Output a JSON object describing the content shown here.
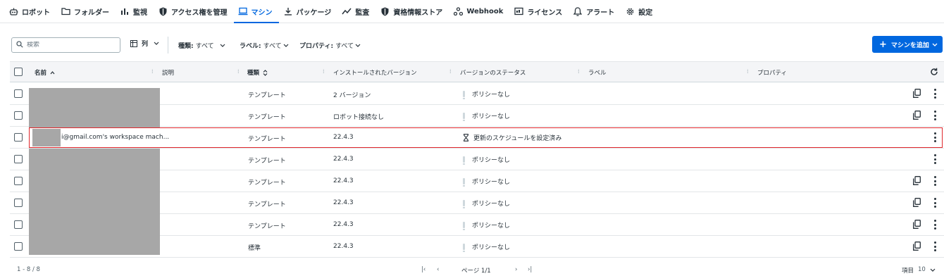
{
  "nav": {
    "items": [
      {
        "label": "ロボット",
        "icon": "robot-icon"
      },
      {
        "label": "フォルダー",
        "icon": "folder-icon"
      },
      {
        "label": "監視",
        "icon": "chart-icon"
      },
      {
        "label": "アクセス権を管理",
        "icon": "shield-icon"
      },
      {
        "label": "マシン",
        "icon": "laptop-icon",
        "active": true
      },
      {
        "label": "パッケージ",
        "icon": "download-icon"
      },
      {
        "label": "監査",
        "icon": "trend-icon"
      },
      {
        "label": "資格情報ストア",
        "icon": "shield-icon"
      },
      {
        "label": "Webhook",
        "icon": "webhook-icon"
      },
      {
        "label": "ライセンス",
        "icon": "license-icon"
      },
      {
        "label": "アラート",
        "icon": "bell-icon"
      },
      {
        "label": "設定",
        "icon": "gear-icon"
      }
    ]
  },
  "toolbar": {
    "search_placeholder": "検索",
    "columns_label": "列",
    "filters": {
      "type_label": "種類:",
      "type_value": "すべて",
      "labels_label": "ラベル:",
      "labels_value": "すべて",
      "props_label": "プロパティ:",
      "props_value": "すべて"
    },
    "add_label": "マシンを追加"
  },
  "table": {
    "headers": {
      "name": "名前",
      "description": "説明",
      "type": "種類",
      "installed_versions": "インストールされたバージョン",
      "version_status": "バージョンのステータス",
      "labels": "ラベル",
      "properties": "プロパティ"
    },
    "rows": [
      {
        "name": "",
        "type": "テンプレート",
        "version": "2 バージョン",
        "status": "ポリシーなし",
        "status_icon": "exclamation-icon",
        "copy": true
      },
      {
        "name": "",
        "type": "テンプレート",
        "version": "ロボット接続なし",
        "status": "ポリシーなし",
        "status_icon": "exclamation-icon",
        "copy": true
      },
      {
        "name": "i@gmail.com's workspace mach...",
        "type": "テンプレート",
        "version": "22.4.3",
        "status": "更新のスケジュールを設定済み",
        "status_icon": "hourglass-icon",
        "copy": false,
        "highlighted": true
      },
      {
        "name": "",
        "type": "テンプレート",
        "version": "22.4.3",
        "status": "ポリシーなし",
        "status_icon": "exclamation-icon",
        "copy": false
      },
      {
        "name": "",
        "type": "テンプレート",
        "version": "22.4.3",
        "status": "ポリシーなし",
        "status_icon": "exclamation-icon",
        "copy": true
      },
      {
        "name": "",
        "type": "テンプレート",
        "version": "22.4.3",
        "status": "ポリシーなし",
        "status_icon": "exclamation-icon",
        "copy": true
      },
      {
        "name": "",
        "type": "テンプレート",
        "version": "22.4.3",
        "status": "ポリシーなし",
        "status_icon": "exclamation-icon",
        "copy": true
      },
      {
        "name": "",
        "type": "標準",
        "version": "22.4.3",
        "status": "ポリシーなし",
        "status_icon": "exclamation-icon",
        "copy": true
      }
    ]
  },
  "footer": {
    "range": "1 - 8 / 8",
    "page": "ページ 1/1",
    "items_label": "項目",
    "items_value": "10"
  },
  "colors": {
    "accent": "#0067df",
    "highlight": "#e0272c",
    "redaction": "#a7a7a7"
  }
}
